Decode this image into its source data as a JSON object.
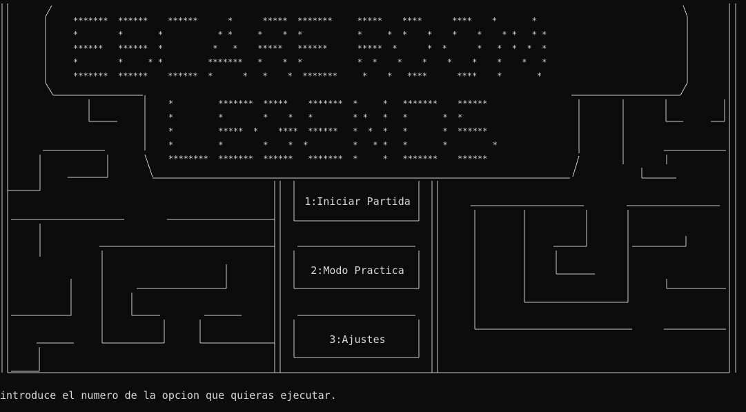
{
  "title_banner": {
    "top_rows": [
      "*******  ******    ******      *      *****  *******     *****    ****      ****    *       *",
      "*        *       *           * *     *    *  *           *     *  *    *    *    *    * *   * *",
      "******   ******  *          *   *    *****   ******      *****  *      *  *      *   *  *  *  *",
      "*        *     * *         *******   *    *  *           *  *    *    *    *    *    *    *   *",
      "*******  ******    ******  *      *   *    *  *******     *    *   ****      ****    *       *"
    ],
    "bottom_rows": [
      "*         *******  *****    *******  *     *   *******    ******",
      "*         *        *    *   *        * *   *   *       *  *",
      "*         *****  *    ****  ******   *  *  *   *       *  ******",
      "*         *        *    *  *         *   * *   *       *         *",
      "********  *******  ******   *******  *     *   *******    ******"
    ]
  },
  "menu": {
    "options": [
      {
        "label": "1:Iniciar Partida"
      },
      {
        "label": "2:Modo Practica"
      },
      {
        "label": "3:Ajustes"
      }
    ]
  },
  "console": {
    "prompt": "introduce el numero de la opcion que quieras ejecutar."
  },
  "colors": {
    "background": "#0c0c0c",
    "foreground": "#cccccc"
  }
}
